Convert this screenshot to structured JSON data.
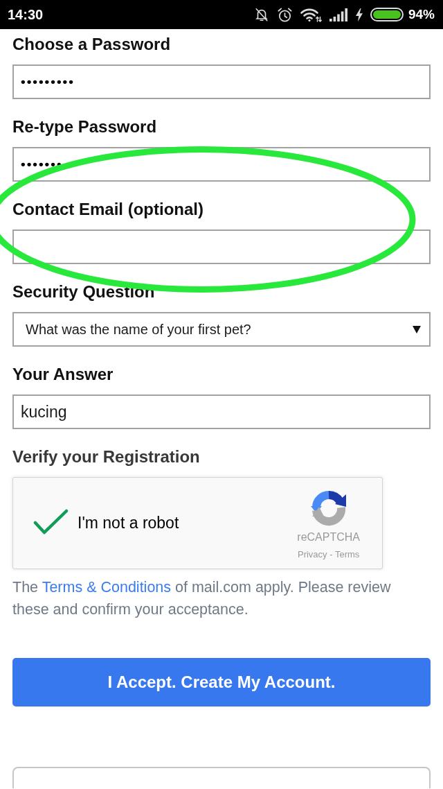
{
  "status_bar": {
    "time": "14:30",
    "battery_percent": "94%"
  },
  "fields": [
    {
      "kind": "password",
      "label": "Choose a Password",
      "value": "•••••••••"
    },
    {
      "kind": "password",
      "label": "Re-type Password",
      "value": "•••••••"
    },
    {
      "kind": "email",
      "label": "Contact Email (optional)"
    },
    {
      "kind": "select",
      "label": "Security Question",
      "value": "What was the name of your first pet?"
    },
    {
      "kind": "text",
      "label": "Your Answer",
      "value": "kucing"
    }
  ],
  "verification": {
    "heading": "Verify your Registration",
    "captcha": {
      "label": "I'm not a robot",
      "checked": true,
      "brand": "reCAPTCHA",
      "links": "Privacy - Terms"
    }
  },
  "terms_notice": {
    "before": "The ",
    "link": "Terms & Conditions",
    "after": " of mail.com apply. Please review these and confirm your acceptance."
  },
  "submit_button": {
    "label": "I Accept. Create My Account."
  },
  "annotations": [
    {
      "kind": "ellipse"
    }
  ]
}
